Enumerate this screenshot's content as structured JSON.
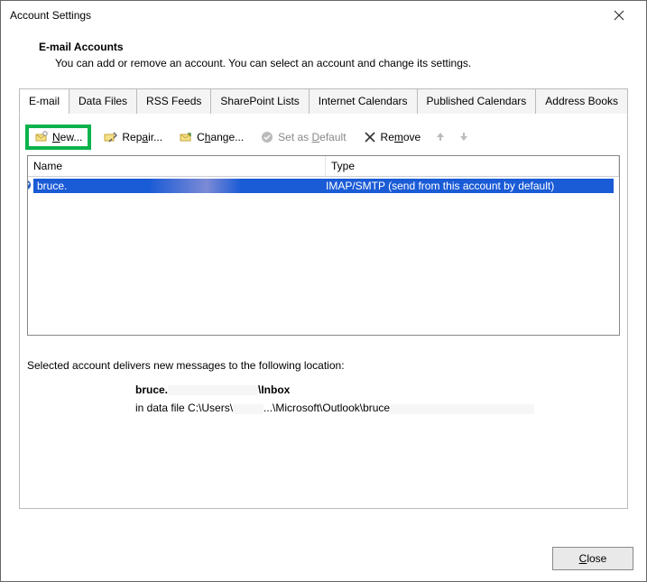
{
  "window": {
    "title": "Account Settings"
  },
  "header": {
    "section_title": "E-mail Accounts",
    "section_desc": "You can add or remove an account. You can select an account and change its settings."
  },
  "tabs": [
    {
      "label": "E-mail",
      "active": true
    },
    {
      "label": "Data Files"
    },
    {
      "label": "RSS Feeds"
    },
    {
      "label": "SharePoint Lists"
    },
    {
      "label": "Internet Calendars"
    },
    {
      "label": "Published Calendars"
    },
    {
      "label": "Address Books"
    }
  ],
  "toolbar": {
    "new_label": "New...",
    "new_u": "N",
    "repair_label": "Repair...",
    "repair_u": "a",
    "change_label": "Change...",
    "change_u": "h",
    "default_label": "Set as Default",
    "default_u": "D",
    "remove_label": "Remove",
    "remove_u": "m"
  },
  "list": {
    "col_name": "Name",
    "col_type": "Type",
    "rows": [
      {
        "name": "bruce.",
        "type": "IMAP/SMTP (send from this account by default)"
      }
    ]
  },
  "deliver": {
    "intro": "Selected account delivers new messages to the following location:",
    "loc_bold_prefix": "bruce.",
    "loc_bold_suffix": "\\Inbox",
    "loc_line2_a": "in data file C:\\Users\\",
    "loc_line2_b": "...\\Microsoft\\Outlook\\bruce"
  },
  "footer": {
    "close_label": "Close",
    "close_u": "C"
  }
}
